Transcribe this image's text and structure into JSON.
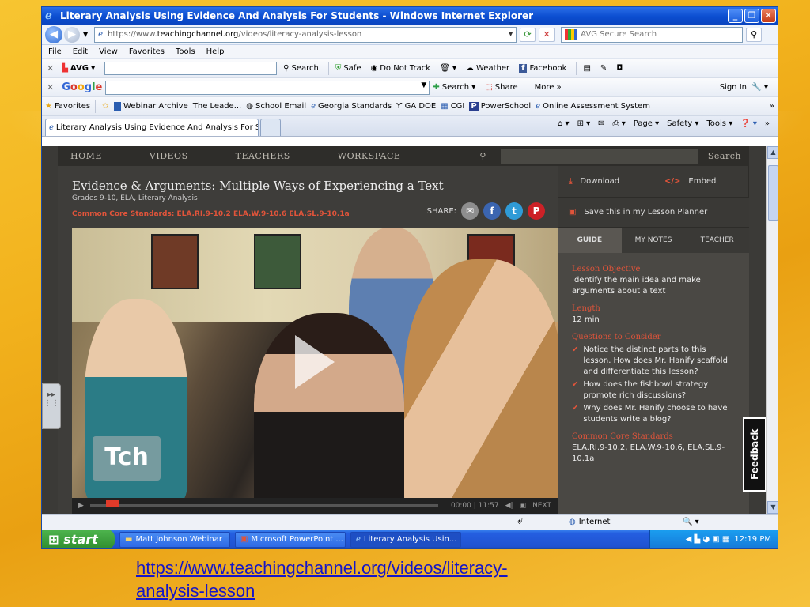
{
  "window": {
    "title": "Literary Analysis Using Evidence And Analysis For Students - Windows Internet Explorer",
    "url_prefix": "https://www.",
    "url_domain": "teachingchannel.org",
    "url_path": "/videos/literacy-analysis-lesson",
    "search_placeholder": "AVG Secure Search"
  },
  "menu": [
    "File",
    "Edit",
    "View",
    "Favorites",
    "Tools",
    "Help"
  ],
  "avg_toolbar": {
    "brand": "AVG",
    "search": "Search",
    "safe": "Safe",
    "do_not_track": "Do Not Track",
    "weather": "Weather",
    "facebook": "Facebook"
  },
  "google_toolbar": {
    "brand_g": "G",
    "brand_o1": "o",
    "brand_o2": "o",
    "brand_g2": "g",
    "brand_l": "l",
    "brand_e": "e",
    "search": "Search",
    "share": "Share",
    "more": "More »",
    "sign_in": "Sign In"
  },
  "favorites": {
    "label": "Favorites",
    "items": [
      "Webinar Archive",
      "The Leade...",
      "School Email",
      "Georgia Standards",
      "GA DOE",
      "CGI",
      "PowerSchool",
      "Online Assessment System"
    ]
  },
  "tab": {
    "label": "Literary Analysis Using Evidence And Analysis For Stu...",
    "page": "Page",
    "safety": "Safety",
    "tools": "Tools"
  },
  "site": {
    "nav": [
      "HOME",
      "VIDEOS",
      "TEACHERS",
      "WORKSPACE"
    ],
    "search": "Search",
    "video_title": "Evidence & Arguments: Multiple Ways of Experiencing a Text",
    "video_subtitle": "Grades 9-10, ELA, Literary Analysis",
    "ccss_line": "Common Core Standards: ELA.RI.9-10.2 ELA.W.9-10.6 ELA.SL.9-10.1a",
    "share_label": "SHARE:",
    "logo": "Tch",
    "time": "00:00 | 11:57",
    "next": "NEXT",
    "download": "Download",
    "embed": "Embed",
    "planner": "Save this in my Lesson Planner",
    "tabs": [
      "GUIDE",
      "MY NOTES",
      "TEACHER"
    ],
    "guide": {
      "objective_h": "Lesson Objective",
      "objective": "Identify the main idea and make arguments about a text",
      "length_h": "Length",
      "length": "12 min",
      "questions_h": "Questions to Consider",
      "questions": [
        "Notice the distinct parts to this lesson. How does Mr. Hanify scaffold and differentiate this lesson?",
        "How does the fishbowl strategy promote rich discussions?",
        "Why does Mr. Hanify choose to have students write a blog?"
      ],
      "ccss_h": "Common Core Standards",
      "ccss": "ELA.RI.9-10.2, ELA.W.9-10.6, ELA.SL.9-10.1a"
    },
    "feedback": "Feedback"
  },
  "status": {
    "zone": "Internet"
  },
  "taskbar": {
    "start": "start",
    "tasks": [
      "Matt Johnson Webinar",
      "Microsoft PowerPoint ...",
      "Literary Analysis Usin..."
    ],
    "clock": "12:19 PM"
  },
  "caption": {
    "line1": "https://www.teachingchannel.org/videos/literacy-",
    "line2": "analysis-lesson"
  }
}
